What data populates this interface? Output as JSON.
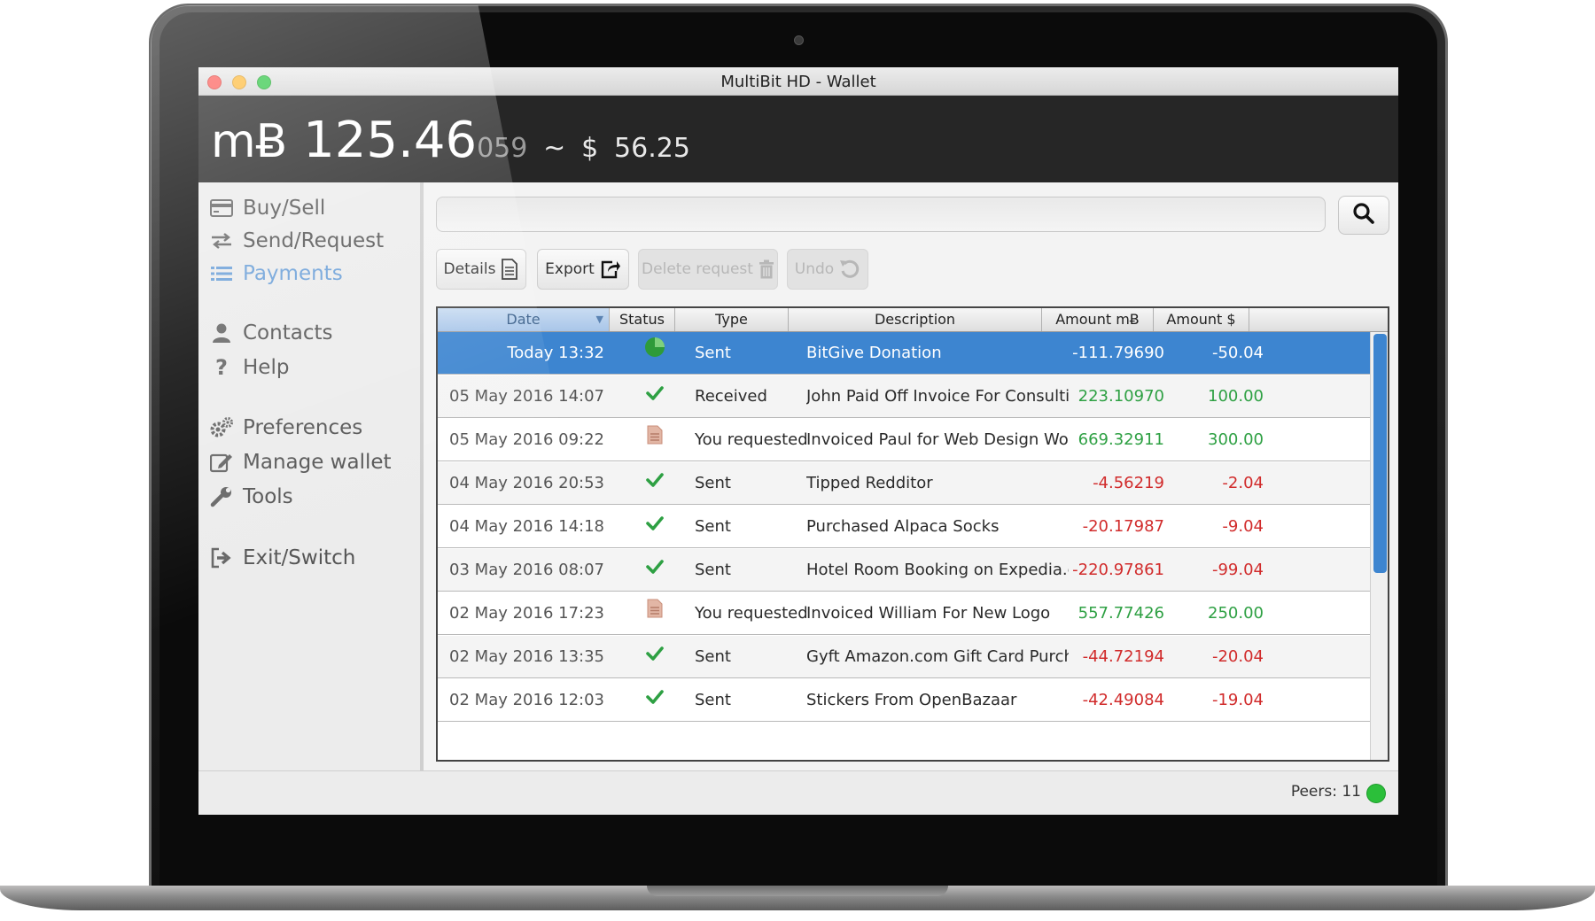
{
  "window": {
    "title": "MultiBit HD - Wallet"
  },
  "balance": {
    "symbol": "mɃ",
    "main": "125.46",
    "small": "059",
    "approx": "~",
    "fiat_symbol": "$",
    "fiat": "56.25"
  },
  "sidebar": {
    "items": [
      {
        "label": "Buy/Sell",
        "icon": "credit-card-icon"
      },
      {
        "label": "Send/Request",
        "icon": "exchange-arrows-icon"
      },
      {
        "label": "Payments",
        "icon": "list-icon",
        "active": true
      },
      {
        "label": "Contacts",
        "icon": "user-icon"
      },
      {
        "label": "Help",
        "icon": "question-icon"
      },
      {
        "label": "Preferences",
        "icon": "gears-icon"
      },
      {
        "label": "Manage wallet",
        "icon": "edit-icon"
      },
      {
        "label": "Tools",
        "icon": "wrench-icon"
      },
      {
        "label": "Exit/Switch",
        "icon": "sign-out-icon"
      }
    ]
  },
  "search": {
    "value": "",
    "placeholder": ""
  },
  "toolbar": {
    "details": "Details",
    "export": "Export",
    "delete_request": "Delete request",
    "undo": "Undo"
  },
  "table": {
    "headers": {
      "date": "Date",
      "status": "Status",
      "type": "Type",
      "description": "Description",
      "amount_btc": "Amount  mɃ",
      "amount_fiat": "Amount $"
    },
    "rows": [
      {
        "date": "Today 13:32",
        "status": "pending",
        "type": "Sent",
        "description": "BitGive Donation",
        "amount_btc": "-111.79690",
        "amount_fiat": "-50.04",
        "sign": "neg",
        "selected": true
      },
      {
        "date": "05 May 2016 14:07",
        "status": "confirmed",
        "type": "Received",
        "description": "John Paid Off Invoice For Consulting",
        "amount_btc": "223.10970",
        "amount_fiat": "100.00",
        "sign": "pos"
      },
      {
        "date": "05 May 2016 09:22",
        "status": "request",
        "type": "You requested",
        "description": "Invoiced Paul for Web Design Work",
        "amount_btc": "669.32911",
        "amount_fiat": "300.00",
        "sign": "pos"
      },
      {
        "date": "04 May 2016 20:53",
        "status": "confirmed",
        "type": "Sent",
        "description": "Tipped Redditor",
        "amount_btc": "-4.56219",
        "amount_fiat": "-2.04",
        "sign": "neg"
      },
      {
        "date": "04 May 2016 14:18",
        "status": "confirmed",
        "type": "Sent",
        "description": "Purchased Alpaca Socks",
        "amount_btc": "-20.17987",
        "amount_fiat": "-9.04",
        "sign": "neg"
      },
      {
        "date": "03 May 2016 08:07",
        "status": "confirmed",
        "type": "Sent",
        "description": "Hotel Room Booking on Expedia.com",
        "amount_btc": "-220.97861",
        "amount_fiat": "-99.04",
        "sign": "neg"
      },
      {
        "date": "02 May 2016 17:23",
        "status": "request",
        "type": "You requested",
        "description": "Invoiced William For New Logo",
        "amount_btc": "557.77426",
        "amount_fiat": "250.00",
        "sign": "pos"
      },
      {
        "date": "02 May 2016 13:35",
        "status": "confirmed",
        "type": "Sent",
        "description": "Gyft Amazon.com Gift Card Purchase",
        "amount_btc": "-44.72194",
        "amount_fiat": "-20.04",
        "sign": "neg"
      },
      {
        "date": "02 May 2016 12:03",
        "status": "confirmed",
        "type": "Sent",
        "description": "Stickers From OpenBazaar",
        "amount_btc": "-42.49084",
        "amount_fiat": "-19.04",
        "sign": "neg"
      }
    ]
  },
  "statusbar": {
    "peers_label": "Peers: 11",
    "peers_color": "#2bbf3a"
  },
  "colors": {
    "selected_row": "#3d85d0",
    "positive": "#2ea043",
    "negative": "#d12b2b",
    "active_nav": "#6a9fd8"
  }
}
